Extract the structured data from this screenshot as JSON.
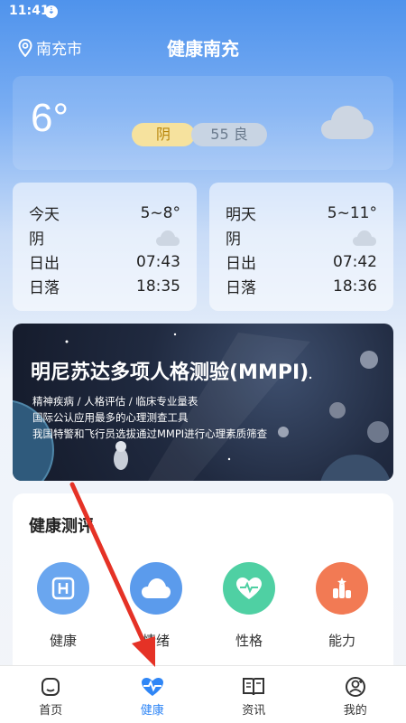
{
  "status": {
    "time": "11:41",
    "download_glyph": "⇣"
  },
  "header": {
    "location": "南充市",
    "title": "健康南充"
  },
  "now": {
    "temp": "6°",
    "condition": "阴",
    "aqi": "55 良"
  },
  "forecast": [
    {
      "day": "今天",
      "range": "5~8°",
      "condition": "阴",
      "sunrise_label": "日出",
      "sunrise": "07:43",
      "sunset_label": "日落",
      "sunset": "18:35"
    },
    {
      "day": "明天",
      "range": "5~11°",
      "condition": "阴",
      "sunrise_label": "日出",
      "sunrise": "07:42",
      "sunset_label": "日落",
      "sunset": "18:36"
    }
  ],
  "banner": {
    "title": "明尼苏达多项人格测验(MMPI)",
    "lines": [
      "精神疾病 / 人格评估 / 临床专业量表",
      "国际公认应用最多的心理测查工具",
      "我国特警和飞行员选拔通过MMPI进行心理素质筛查"
    ]
  },
  "assessment": {
    "title": "健康测评",
    "items": [
      {
        "label": "健康",
        "icon": "hospital-icon",
        "color": "#6aa6ef"
      },
      {
        "label": "情绪",
        "icon": "cloud-icon",
        "color": "#5b9bec"
      },
      {
        "label": "性格",
        "icon": "heart-pulse-icon",
        "color": "#4fd0a3"
      },
      {
        "label": "能力",
        "icon": "chart-bars-icon",
        "color": "#f27a54"
      }
    ]
  },
  "nav": [
    {
      "label": "首页",
      "icon": "home-icon"
    },
    {
      "label": "健康",
      "icon": "heart-pulse-icon"
    },
    {
      "label": "资讯",
      "icon": "book-icon"
    },
    {
      "label": "我的",
      "icon": "user-icon"
    }
  ],
  "colors": {
    "accent": "#2f86f6",
    "annotation_arrow": "#e53226"
  }
}
